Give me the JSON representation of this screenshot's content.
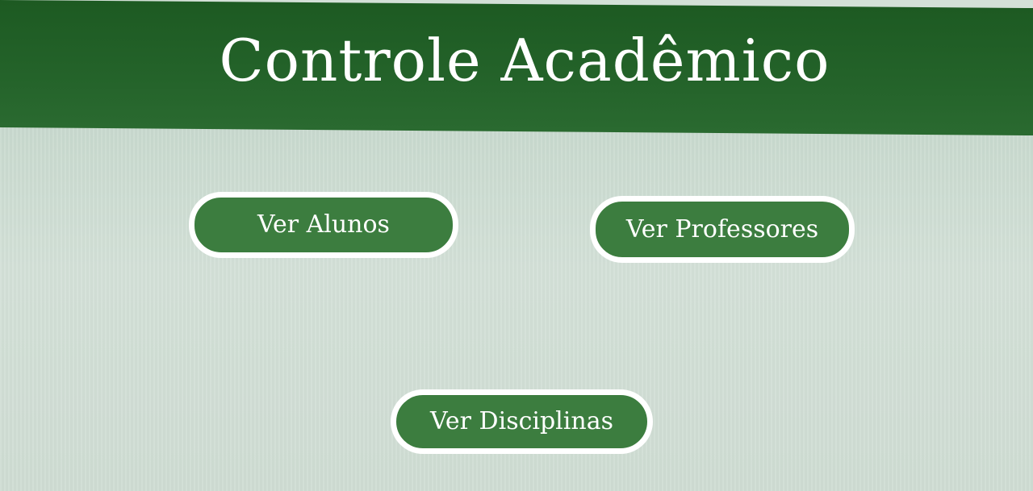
{
  "header": {
    "title": "Controle Acadêmico"
  },
  "buttons": {
    "alunos": "Ver Alunos",
    "professores": "Ver Professores",
    "disciplinas": "Ver Disciplinas"
  },
  "colors": {
    "header_background": "#1f5d24",
    "page_background": "#d3e0d7",
    "button_background": "#3c7d3f",
    "button_border": "#ffffff",
    "text": "#ffffff"
  }
}
